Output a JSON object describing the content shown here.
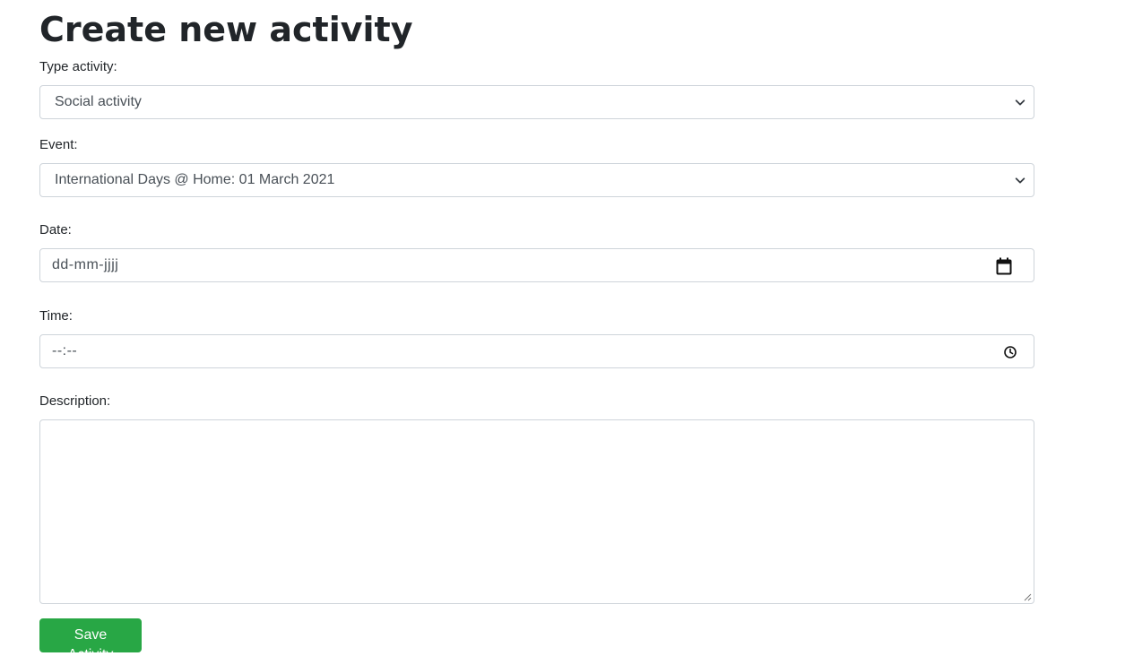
{
  "page": {
    "title": "Create new activity"
  },
  "form": {
    "type_activity": {
      "label": "Type activity:",
      "value": "Social activity"
    },
    "event": {
      "label": "Event:",
      "value": "International Days @ Home: 01 March 2021"
    },
    "date": {
      "label": "Date:",
      "placeholder": "dd-mm-jjjj"
    },
    "time": {
      "label": "Time:",
      "placeholder": "--:--"
    },
    "description": {
      "label": "Description:",
      "value": ""
    },
    "submit_label": "Save Activity"
  },
  "colors": {
    "accent": "#28a745",
    "border": "#ced4da",
    "text": "#212529"
  },
  "icons": {
    "select_arrow": "chevron-down-icon",
    "date": "calendar-icon",
    "time": "clock-icon",
    "resize": "resize-handle-icon"
  }
}
